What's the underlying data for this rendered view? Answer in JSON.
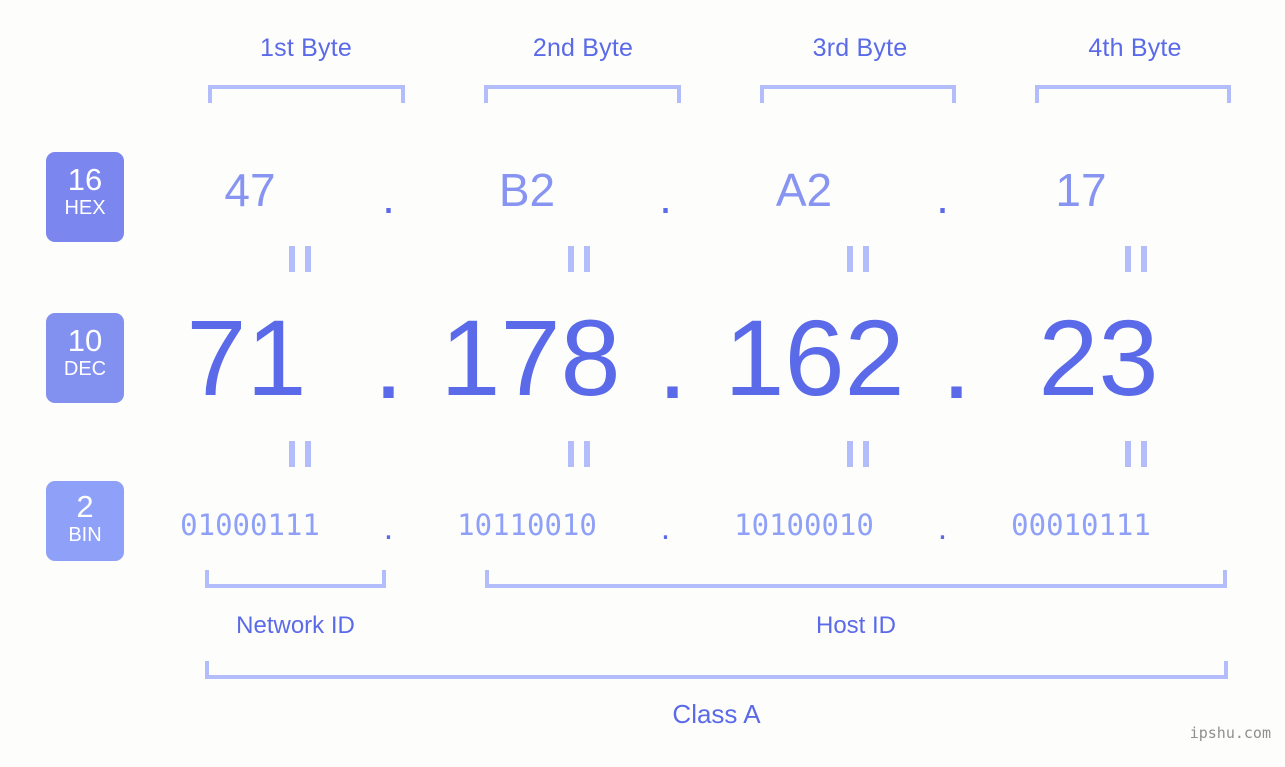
{
  "background_color": "#fdfefb",
  "accent_color": "#5b6ae8",
  "light_accent_color": "#b4bdfb",
  "byte_headings": [
    {
      "label": "1st Byte"
    },
    {
      "label": "2nd Byte"
    },
    {
      "label": "3rd Byte"
    },
    {
      "label": "4th Byte"
    }
  ],
  "bases": [
    {
      "number": "16",
      "abbr": "HEX",
      "badge_color": "#7b86ee"
    },
    {
      "number": "10",
      "abbr": "DEC",
      "badge_color": "#8290f0"
    },
    {
      "number": "2",
      "abbr": "BIN",
      "badge_color": "#8fa0f8"
    }
  ],
  "separator": ".",
  "equals_symbol": "||",
  "rows": {
    "hex": {
      "octets": [
        "47",
        "B2",
        "A2",
        "17"
      ],
      "text_color": "#8794f2"
    },
    "dec": {
      "octets": [
        "71",
        "178",
        "162",
        "23"
      ],
      "text_color": "#5b6ae8"
    },
    "bin": {
      "octets": [
        "01000111",
        "10110010",
        "10100010",
        "00010111"
      ],
      "text_color": "#8fa0f8"
    }
  },
  "regions": [
    {
      "label": "Network ID"
    },
    {
      "label": "Host ID"
    }
  ],
  "class": {
    "label": "Class A"
  },
  "watermark": {
    "text": "ipshu.com"
  }
}
